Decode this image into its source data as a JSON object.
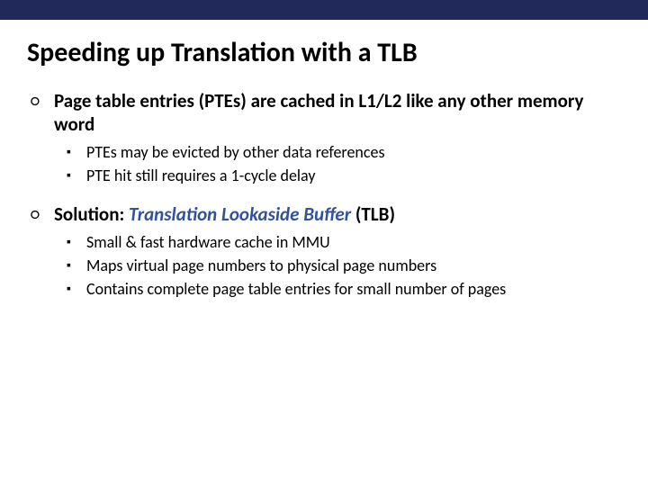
{
  "title": "Speeding up Translation with a TLB",
  "b1": {
    "text": "Page table entries (PTEs) are cached in L1/L2 like any other memory word",
    "sub": [
      "PTEs may be evicted by other data references",
      "PTE hit still requires a 1-cycle delay"
    ]
  },
  "b2": {
    "prefix": "Solution: ",
    "emph": "Translation Lookaside Buffer",
    "suffix": " (TLB)",
    "sub": [
      "Small & fast hardware cache in MMU",
      "Maps virtual page numbers to  physical page numbers",
      "Contains complete page table entries for small number of pages"
    ]
  }
}
